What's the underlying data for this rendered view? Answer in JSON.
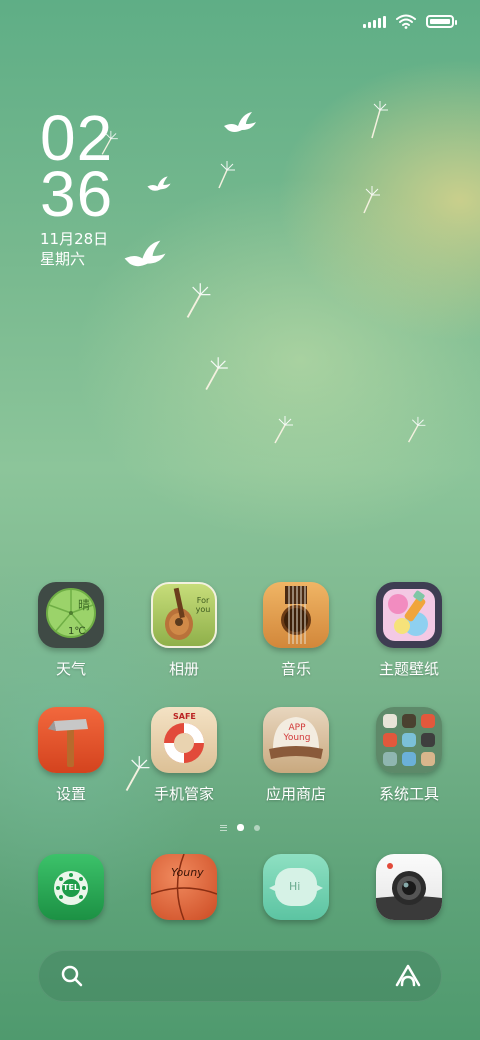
{
  "status_bar": {
    "signal_icon": "signal-bars-icon",
    "wifi_icon": "wifi-icon",
    "battery_icon": "battery-icon",
    "battery_level": 1.0
  },
  "clock": {
    "hour": "02",
    "minute": "36",
    "date": "11月28日",
    "weekday": "星期六"
  },
  "home_apps": [
    {
      "label": "天气",
      "icon": "umbrella-weather-icon",
      "icon_text": "晴",
      "temp_text": "1℃"
    },
    {
      "label": "相册",
      "icon": "guitar-photo-album-icon",
      "icon_text": "For you"
    },
    {
      "label": "音乐",
      "icon": "guitar-music-icon"
    },
    {
      "label": "主题壁纸",
      "icon": "paint-brush-theme-icon"
    },
    {
      "label": "设置",
      "icon": "hammer-settings-icon"
    },
    {
      "label": "手机管家",
      "icon": "lifebuoy-security-icon",
      "icon_text": "SAFE"
    },
    {
      "label": "应用商店",
      "icon": "cap-app-store-icon",
      "icon_text": "APP Young"
    },
    {
      "label": "系统工具",
      "icon": "folder-system-tools-icon"
    }
  ],
  "page_indicator": {
    "pages": 2,
    "current": 1
  },
  "dock": [
    {
      "name": "phone",
      "icon": "rotary-phone-icon",
      "icon_text": "TEL"
    },
    {
      "name": "messages",
      "icon": "basketball-messages-icon",
      "icon_text": "Youny"
    },
    {
      "name": "chat",
      "icon": "hi-bubble-icon",
      "icon_text": "Hi"
    },
    {
      "name": "camera",
      "icon": "camera-icon"
    }
  ],
  "search_bar": {
    "search_icon": "search-icon",
    "assistant_icon": "assistant-icon"
  },
  "colors": {
    "wallpaper_green": "#78b98f",
    "wallpaper_gold": "#e6d78c",
    "text": "#ffffff"
  }
}
